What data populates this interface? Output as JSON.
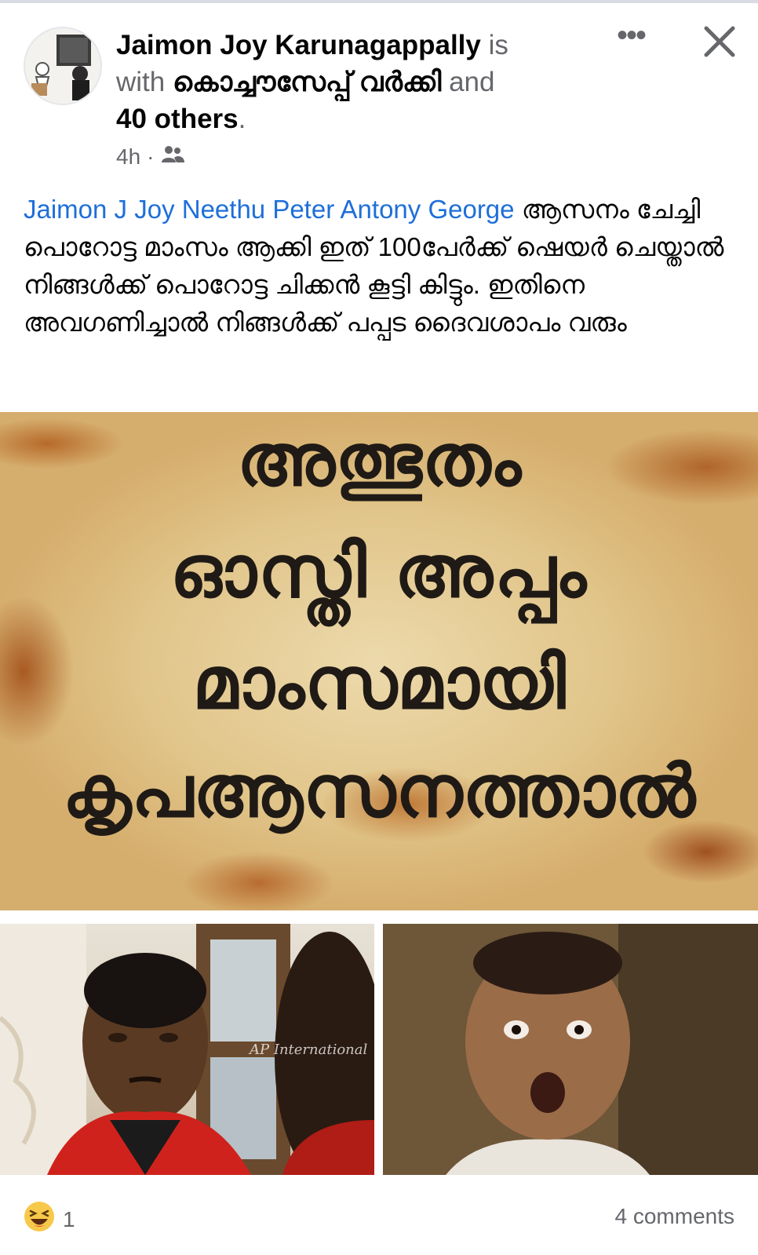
{
  "post": {
    "author": "Jaimon Joy Karunagappally",
    "is_word": " is",
    "with_word": "with ",
    "tagged_friend": "കൊച്ചൗസേപ്പ് വർക്കി",
    "and_word": " and",
    "others": "40 others",
    "period": ".",
    "time": "4h",
    "separator": " · ",
    "audience_icon": "friends-icon",
    "more_label": "•••",
    "close_icon": "close-icon"
  },
  "caption": {
    "tags": "Jaimon J Joy Neethu Peter Antony George",
    "text": " ആസനം ചേച്ചി പൊറോട്ട മാംസം ആക്കി   ഇത് 100പേർക്ക് ഷെയർ ചെയ്താൽ നിങ്ങൾക്ക് പൊറോട്ട ചിക്കൻ കൂട്ടി കിട്ടും. ഇതിനെ അവഗണിച്ചാൽ നിങ്ങൾക്ക് പപ്പട ദൈവശാപം വരും"
  },
  "meme": {
    "line1": "അത്ഭുതം",
    "line2": "ഓസ്തി  അപ്പം",
    "line3": "മാംസമായി",
    "line4": "കൃപആസനത്താൽ",
    "watermark": "AP International"
  },
  "footer": {
    "reaction_icon": "laughing-emoji-icon",
    "reaction_count": "1",
    "comments": "4 comments"
  },
  "colors": {
    "tag_blue": "#1e6fd9",
    "secondary_text": "#65676b",
    "primary_text": "#050505"
  }
}
